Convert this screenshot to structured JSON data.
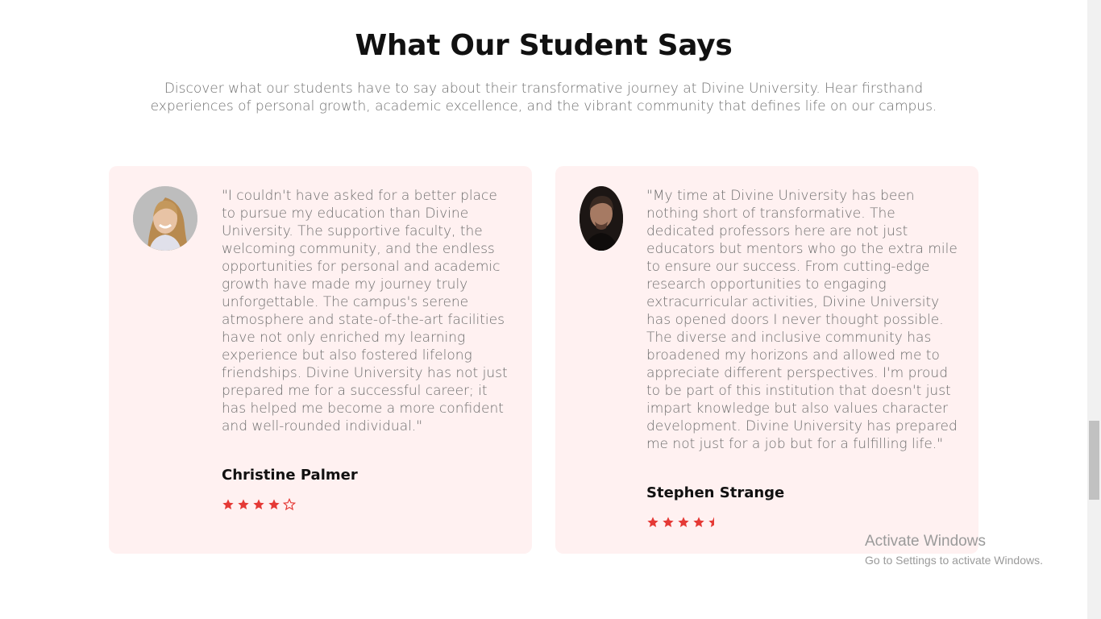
{
  "section": {
    "title": "What Our Student Says",
    "intro_line1": "Discover what our students have to say about their transformative journey at Divine University. Hear firsthand",
    "intro_line2": "experiences of personal growth, academic excellence, and the vibrant community that defines life on our campus."
  },
  "testimonials": [
    {
      "quote": "\"I couldn't have asked for a better place to pursue my education than Divine University. The supportive faculty, the welcoming community, and the endless opportunities for personal and academic growth have made my journey truly unforgettable. The campus's serene atmosphere and state-of-the-art facilities have not only enriched my learning experience but also fostered lifelong friendships. Divine University has not just prepared me for a successful career; it has helped me become a more confident and well-rounded individual.\"",
      "name": "Christine Palmer",
      "rating": 4,
      "avatar_icon": "student-photo"
    },
    {
      "quote": "\"My time at Divine University has been nothing short of transformative. The dedicated professors here are not just educators but mentors who go the extra mile to ensure our success. From cutting-edge research opportunities to engaging extracurricular activities, Divine University has opened doors I never thought possible. The diverse and inclusive community has broadened my horizons and allowed me to appreciate different perspectives. I'm proud to be part of this institution that doesn't just impart knowledge but also values character development. Divine University has prepared me not just for a job but for a fulfilling life.\"",
      "name": "Stephen Strange",
      "rating": 4.5,
      "avatar_icon": "student-photo"
    }
  ],
  "colors": {
    "card_background": "#fff1f1",
    "star": "#e53935",
    "title": "#111111",
    "body_text": "#6d6d6d"
  },
  "os_watermark": {
    "line1": "Activate Windows",
    "line2": "Go to Settings to activate Windows."
  }
}
